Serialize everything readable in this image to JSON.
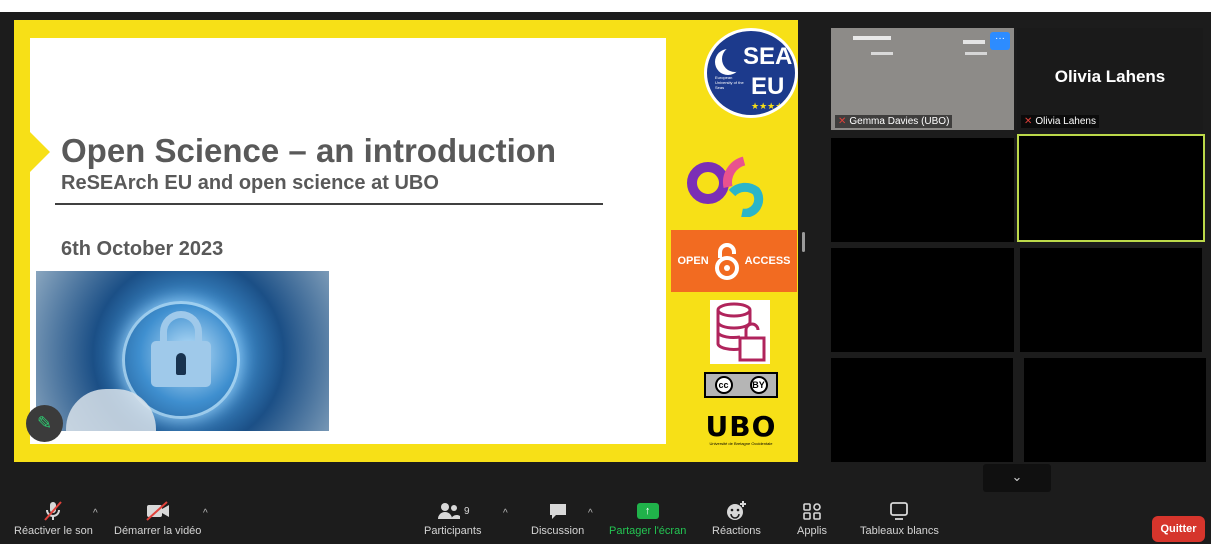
{
  "slide": {
    "title": "Open Science – an introduction",
    "subtitle": "ReSEArch EU and open science at UBO",
    "date": "6th October 2023",
    "logos": {
      "sea_top": "SEA",
      "sea_bottom": "EU",
      "sea_small": "European University of the Seas",
      "open_access_left": "OPEN",
      "open_access_right": "ACCESS",
      "cc_by": "BY",
      "ubo": "UBO",
      "ubo_sub": "Université de Bretagne Occidentale"
    }
  },
  "participants": {
    "gemma": "Gemma Davies (UBO)",
    "olivia_big": "Olivia Lahens",
    "olivia_label": "Olivia Lahens",
    "more_button": "···"
  },
  "toolbar": {
    "unmute_label": "Réactiver le son",
    "start_video_label": "Démarrer la vidéo",
    "participants_label": "Participants",
    "participants_count": "9",
    "chat_label": "Discussion",
    "share_label": "Partager l'écran",
    "reactions_label": "Réactions",
    "apps_label": "Applis",
    "whiteboards_label": "Tableaux blancs",
    "leave_label": "Quitter"
  },
  "colors": {
    "slide_yellow": "#f7e017",
    "share_green": "#20b24a",
    "leave_red": "#d6352c",
    "active_speaker_border": "#bcd94a",
    "open_access_orange": "#f26b21"
  },
  "icons": {
    "mic": "mic-off-icon",
    "video": "video-off-icon",
    "participants": "people-icon",
    "chat": "chat-bubble-icon",
    "share": "share-screen-icon",
    "reactions": "smiley-plus-icon",
    "apps": "apps-icon",
    "whiteboards": "whiteboard-icon",
    "annotate": "pencil-icon",
    "collapse": "chevron-down-icon"
  }
}
